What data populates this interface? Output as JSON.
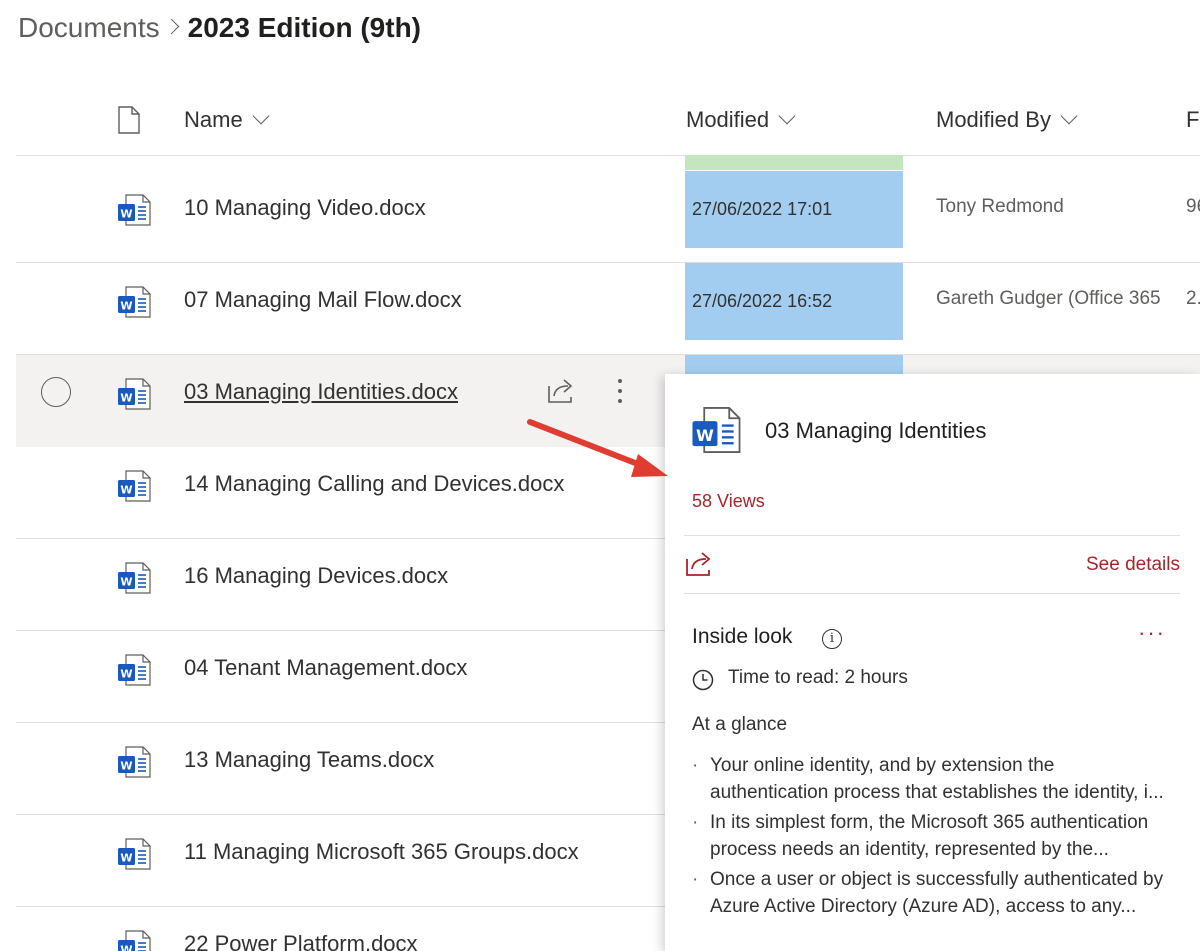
{
  "breadcrumb": {
    "root": "Documents",
    "current": "2023 Edition (9th)"
  },
  "columns": {
    "name": "Name",
    "modified": "Modified",
    "modified_by": "Modified By",
    "file_size": "F"
  },
  "rows": [
    {
      "name": "10 Managing Video.docx",
      "modified": "27/06/2022 17:01",
      "modified_by": "Tony Redmond",
      "size": "96"
    },
    {
      "name": "07 Managing Mail Flow.docx",
      "modified": "27/06/2022 16:52",
      "modified_by": "Gareth Gudger (Office 365",
      "size": "2."
    },
    {
      "name": "03 Managing Identities.docx",
      "modified": "",
      "modified_by": "",
      "size": ""
    },
    {
      "name": "14 Managing Calling and Devices.docx"
    },
    {
      "name": "16 Managing Devices.docx"
    },
    {
      "name": "04 Tenant Management.docx"
    },
    {
      "name": "13 Managing Teams.docx"
    },
    {
      "name": "11 Managing Microsoft 365 Groups.docx"
    },
    {
      "name": "22 Power Platform.docx"
    }
  ],
  "card": {
    "title": "03 Managing Identities",
    "views": "58 Views",
    "see_details": "See details",
    "inside_look": "Inside look",
    "info_glyph": "i",
    "more_glyph": "···",
    "time_to_read": "Time to read: 2 hours",
    "at_a_glance": "At a glance",
    "bullets": [
      [
        "Your online identity, and by extension the",
        "authentication process that establishes the identity, i..."
      ],
      [
        "In its simplest form, the Microsoft 365 authentication",
        "process needs an identity, represented by the..."
      ],
      [
        "Once a user or object is successfully authenticated by",
        "Azure Active Directory (Azure AD), access to any..."
      ]
    ]
  },
  "colors": {
    "modified_highlight": "#a3cdf0",
    "header_highlight": "#c3e6c1",
    "accent": "#a4262c",
    "word_blue": "#185abd",
    "arrow": "#e03c31"
  },
  "icons": {
    "file_type": "word-doc-icon",
    "share": "share-icon",
    "more": "more-vertical-icon",
    "clock": "clock-icon",
    "info": "info-icon"
  }
}
